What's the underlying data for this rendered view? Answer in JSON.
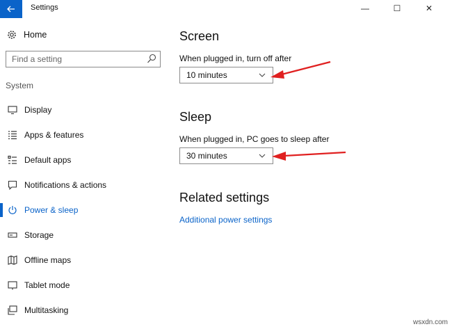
{
  "window": {
    "title": "Settings",
    "minimize_glyph": "—",
    "maximize_glyph": "☐",
    "close_glyph": "✕"
  },
  "sidebar": {
    "home_label": "Home",
    "search_placeholder": "Find a setting",
    "group_label": "System",
    "items": [
      {
        "label": "Display",
        "icon": "display-icon"
      },
      {
        "label": "Apps & features",
        "icon": "apps-list-icon"
      },
      {
        "label": "Default apps",
        "icon": "default-apps-icon"
      },
      {
        "label": "Notifications & actions",
        "icon": "notifications-icon"
      },
      {
        "label": "Power & sleep",
        "icon": "power-icon",
        "active": true
      },
      {
        "label": "Storage",
        "icon": "storage-icon"
      },
      {
        "label": "Offline maps",
        "icon": "map-icon"
      },
      {
        "label": "Tablet mode",
        "icon": "tablet-icon"
      },
      {
        "label": "Multitasking",
        "icon": "multitasking-icon"
      }
    ]
  },
  "main": {
    "screen": {
      "heading": "Screen",
      "label": "When plugged in, turn off after",
      "value": "10 minutes"
    },
    "sleep": {
      "heading": "Sleep",
      "label": "When plugged in, PC goes to sleep after",
      "value": "30 minutes"
    },
    "related": {
      "heading": "Related settings",
      "link": "Additional power settings"
    }
  },
  "watermark": "wsxdn.com",
  "colors": {
    "accent": "#0a63c9",
    "annotation_arrow": "#e02020"
  }
}
